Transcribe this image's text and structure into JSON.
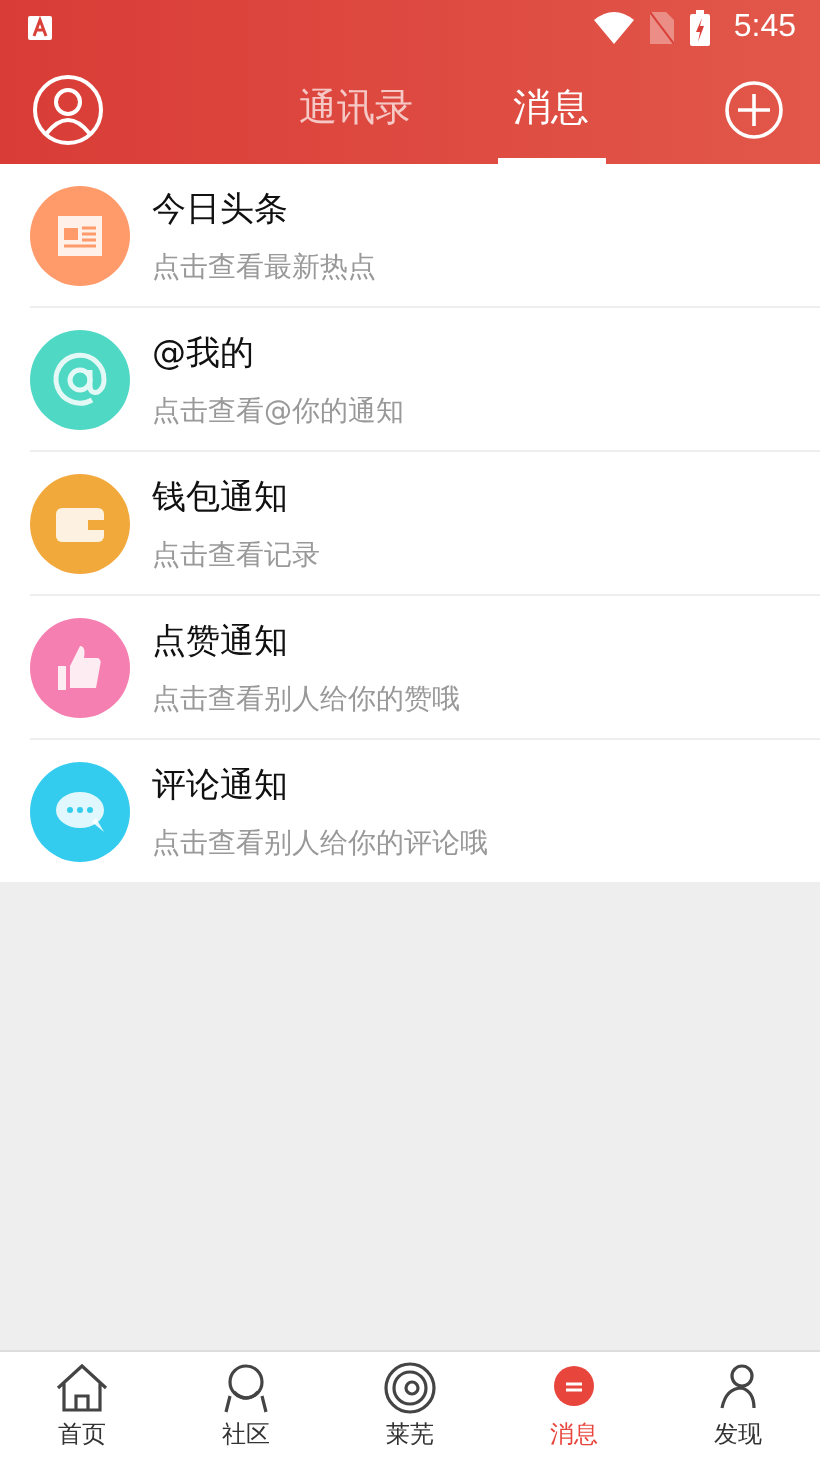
{
  "status_bar": {
    "time": "5:45"
  },
  "header": {
    "tabs": [
      {
        "label": "通讯录",
        "selected": false
      },
      {
        "label": "消息",
        "selected": true
      }
    ]
  },
  "messages": [
    {
      "kind": "news",
      "color": "#ff9a6b",
      "title": "今日头条",
      "subtitle": "点击查看最新热点"
    },
    {
      "kind": "at",
      "color": "#4fd8c4",
      "title": "@我的",
      "subtitle": "点击查看@你的通知"
    },
    {
      "kind": "wallet",
      "color": "#f2a93b",
      "title": "钱包通知",
      "subtitle": "点击查看记录"
    },
    {
      "kind": "like",
      "color": "#f47fb0",
      "title": "点赞通知",
      "subtitle": "点击查看别人给你的赞哦"
    },
    {
      "kind": "comment",
      "color": "#33ccee",
      "title": "评论通知",
      "subtitle": "点击查看别人给你的评论哦"
    }
  ],
  "bottom_nav": [
    {
      "kind": "home",
      "label": "首页",
      "selected": false
    },
    {
      "kind": "community",
      "label": "社区",
      "selected": false
    },
    {
      "kind": "planet",
      "label": "莱芜",
      "selected": false
    },
    {
      "kind": "message",
      "label": "消息",
      "selected": true
    },
    {
      "kind": "discover",
      "label": "发现",
      "selected": false
    }
  ]
}
